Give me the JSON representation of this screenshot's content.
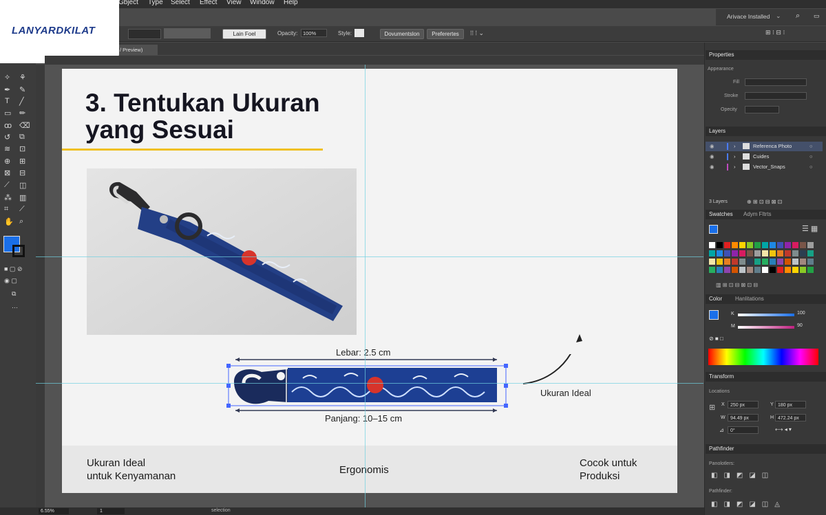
{
  "menubar": {
    "items": [
      "Gbject",
      "Type",
      "Select",
      "Effect",
      "View",
      "Window",
      "Help"
    ]
  },
  "logo": {
    "text": "LANYARDKILAT"
  },
  "top_right": {
    "workspace": "Arivace Installed"
  },
  "controlbar": {
    "stroke_value": "Lain Foel",
    "opacity_label": "Opacity:",
    "opacity_value": "100%",
    "style_label": "Style:",
    "doc_setup_button": "Dovumentslon",
    "preferences_button": "Preferertes"
  },
  "tab": {
    "label": "/ Preview)"
  },
  "slide": {
    "title_line1": "3. Tentukan Ukuran",
    "title_line2": "yang Sesuai",
    "lebar": "Lebar: 2.5 cm",
    "panjang": "Panjang: 10–15 cm",
    "ideal": "Ukuran Ideal",
    "bottom": [
      {
        "line1": "Ukuran Ideal",
        "line2": "untuk Kenyamanan"
      },
      {
        "line1": "Ergonomis",
        "line2": ""
      },
      {
        "line1": "Cocok untuk",
        "line2": "Produksi"
      }
    ]
  },
  "statusbar": {
    "zoom": "6.55%",
    "artboard": "1",
    "mode": "selection"
  },
  "panels": {
    "properties": {
      "title": "Properties",
      "appearance": "Appearance",
      "fill": "Fill",
      "stroke": "Stroke",
      "opacity": "Opecity"
    },
    "layers": {
      "title": "Layers",
      "items": [
        "Referenca Photo",
        "Cuides",
        "Vector_Snaps"
      ],
      "footer": "3 Layers",
      "colors": [
        "#4a7cff",
        "#4a7cff",
        "#c04ac0"
      ]
    },
    "swatches": {
      "title": "Swatches",
      "tab2": "Adym Fltrts"
    },
    "color": {
      "title": "Color",
      "tab2": "Hanlitations",
      "k_label": "K",
      "k_value": "100",
      "m_label": "M",
      "m_value": "90",
      "fill_color": "#1a6fe8"
    },
    "transform": {
      "title": "Transform",
      "locations": "Locations",
      "x_label": "X",
      "x_value": "250 px",
      "y_label": "Y",
      "y_value": "180 px",
      "w_label": "W",
      "w_value": "94.49 px",
      "h_label": "H",
      "h_value": "472.24 px",
      "angle_value": "0°"
    },
    "pathfinder": {
      "title": "Pathfinder",
      "shape_modes": "Panolotlers:",
      "pathfinders": "Pathfinder:"
    }
  },
  "colors": {
    "accent_blue": "#1a6fe8",
    "underline_yellow": "#f0c020",
    "guide_cyan": "#6fd0e0"
  }
}
